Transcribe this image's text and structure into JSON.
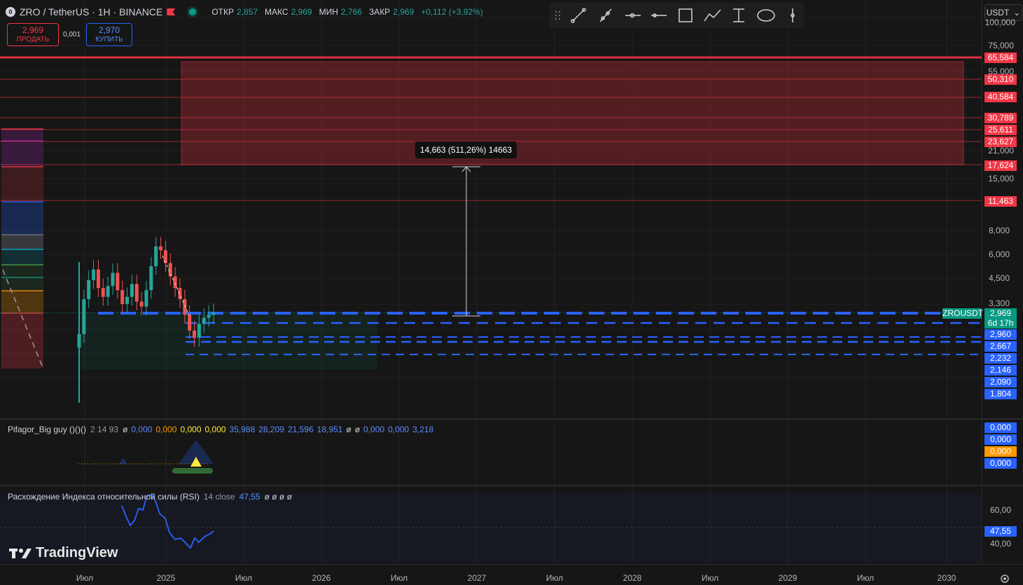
{
  "header": {
    "symbol": "ZRO / TetherUS · 1H · BINANCE",
    "logo_letter": "0",
    "ohlc": [
      {
        "label": "ОТКР",
        "value": "2,857"
      },
      {
        "label": "МАКС",
        "value": "2,969"
      },
      {
        "label": "МИН",
        "value": "2,766"
      },
      {
        "label": "ЗАКР",
        "value": "2,969"
      }
    ],
    "change": "+0,112 (+3,92%)"
  },
  "trade": {
    "sell_price": "2,969",
    "sell_label": "ПРОДАТЬ",
    "spread": "0,001",
    "buy_price": "2,970",
    "buy_label": "КУПИТЬ"
  },
  "currency": "USDT",
  "toolbar_icons": [
    "drag-handle-icon",
    "trend-line-icon",
    "ray-icon",
    "horizontal-ray-icon",
    "horizontal-line-icon",
    "rectangle-icon",
    "path-icon",
    "vertical-range-icon",
    "ellipse-icon",
    "vertical-line-icon"
  ],
  "price_axis": {
    "ticks": [
      "100,000",
      "75,000",
      "55,000",
      "21,000",
      "15,000",
      "8,000",
      "6,000",
      "4,500",
      "3,300"
    ],
    "red_tags": [
      "65,584",
      "50,310",
      "40,584",
      "30,789",
      "25,611",
      "23,627",
      "17,624",
      "11,463"
    ],
    "blue_tags": [
      "2,960",
      "2,667",
      "2,232",
      "2,146",
      "2,090",
      "1,804"
    ],
    "last_price": "2,969",
    "countdown": "6d 17h",
    "symbol_tag": "ZROUSDT"
  },
  "measure_label": "14,663 (511,26%) 14663",
  "time_axis": [
    "Июл",
    "2025",
    "Июл",
    "2026",
    "Июл",
    "2027",
    "Июл",
    "2028",
    "Июл",
    "2029",
    "Июл",
    "2030"
  ],
  "indicator1": {
    "name": "Pifagor_Big guy ()()()",
    "params": "2 14 93",
    "values": [
      {
        "t": "ø",
        "c": "#d1d4dc"
      },
      {
        "t": "0,000",
        "c": "#5b8cff"
      },
      {
        "t": "0,000",
        "c": "#ff9800"
      },
      {
        "t": "0,000",
        "c": "#ffeb3b"
      },
      {
        "t": "0,000",
        "c": "#ffeb3b"
      },
      {
        "t": "35,988",
        "c": "#5b8cff"
      },
      {
        "t": "28,209",
        "c": "#5b8cff"
      },
      {
        "t": "21,596",
        "c": "#5b8cff"
      },
      {
        "t": "18,951",
        "c": "#5b8cff"
      },
      {
        "t": "ø",
        "c": "#d1d4dc"
      },
      {
        "t": "ø",
        "c": "#d1d4dc"
      },
      {
        "t": "0,000",
        "c": "#5b8cff"
      },
      {
        "t": "0,000",
        "c": "#5b8cff"
      },
      {
        "t": "3,218",
        "c": "#5b8cff"
      }
    ],
    "axis_tags": [
      {
        "t": "0,000",
        "c": "#2962ff"
      },
      {
        "t": "0,000",
        "c": "#2962ff"
      },
      {
        "t": "0,000",
        "c": "#ff9800"
      },
      {
        "t": "0,000",
        "c": "#2962ff"
      }
    ]
  },
  "indicator2": {
    "name": "Расхождение Индекса относительной силы (RSI)",
    "params": "14 close",
    "value": "47,55",
    "extra": "ø ø ø ø",
    "ticks": [
      "60,00",
      "40,00"
    ],
    "current_tag": "47,55"
  },
  "brand": "TradingView",
  "colors": {
    "up": "#26a69a",
    "down": "#ef5350",
    "accent_blue": "#2962ff",
    "zone_red": "#f23645",
    "bg": "#161616"
  },
  "chart_data": {
    "type": "candlestick",
    "symbol": "ZRO / TetherUS",
    "interval": "1H",
    "y_scale": "log",
    "x": [
      "Июл",
      "2025",
      "Июл",
      "2026",
      "Июл",
      "2027",
      "Июл",
      "2028",
      "Июл",
      "2029",
      "Июл",
      "2030"
    ],
    "close_series_approx": [
      2.3,
      3.5,
      4.4,
      5.0,
      4.0,
      3.6,
      4.1,
      4.8,
      3.9,
      3.3,
      3.6,
      4.2,
      3.4,
      3.2,
      3.9,
      5.2,
      6.6,
      6.3,
      5.4,
      4.6,
      4.0,
      3.5,
      2.9,
      2.4,
      2.2,
      2.6,
      2.8,
      2.9,
      2.97
    ],
    "resistance_levels": [
      65.584,
      50.31,
      40.584,
      30.789,
      25.611,
      23.627,
      17.624,
      11.463
    ],
    "support_levels": [
      2.96,
      2.667,
      2.232,
      2.146,
      2.09,
      1.804
    ],
    "measure": {
      "from": 2.969,
      "to": 17.624,
      "delta": 14.663,
      "percent": 511.26
    },
    "rsi": {
      "period": 14,
      "source": "close",
      "value": 47.55,
      "levels": [
        60,
        40
      ]
    }
  }
}
